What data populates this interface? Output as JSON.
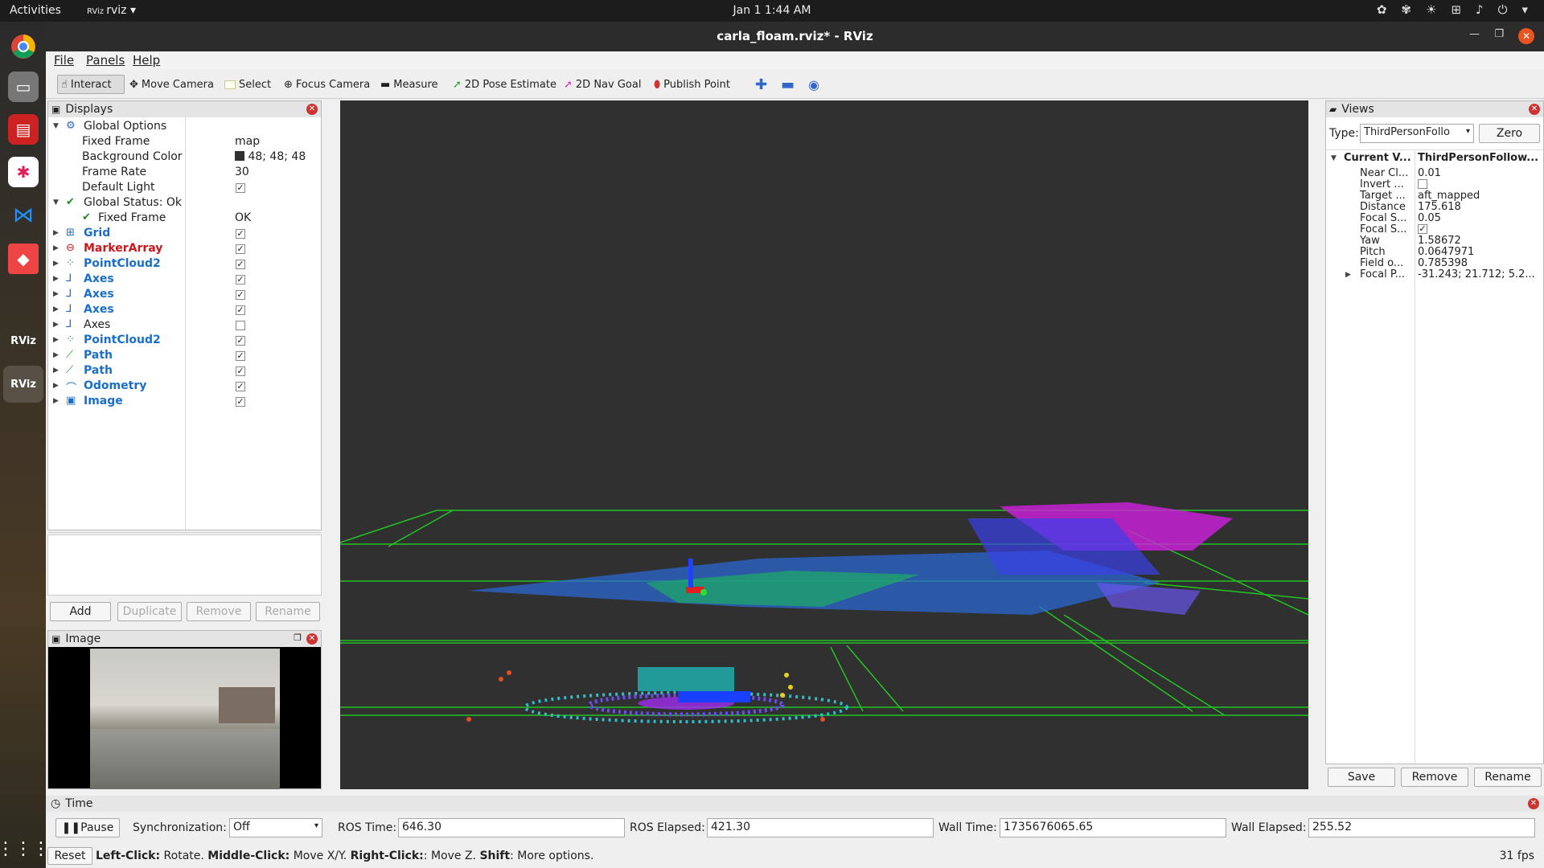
{
  "system": {
    "activities": "Activities",
    "app_menu": "rviz",
    "clock": "Jan 1  1:44 AM"
  },
  "window": {
    "title": "carla_floam.rviz* - RViz"
  },
  "menu": {
    "file": "File",
    "panels": "Panels",
    "help": "Help"
  },
  "toolbar": {
    "interact": "Interact",
    "move_camera": "Move Camera",
    "select": "Select",
    "focus_camera": "Focus Camera",
    "measure": "Measure",
    "pose_estimate": "2D Pose Estimate",
    "nav_goal": "2D Nav Goal",
    "publish_point": "Publish Point"
  },
  "displays": {
    "title": "Displays",
    "global_options": "Global Options",
    "fixed_frame_label": "Fixed Frame",
    "fixed_frame_value": "map",
    "bg_color_label": "Background Color",
    "bg_color_value": "48; 48; 48",
    "frame_rate_label": "Frame Rate",
    "frame_rate_value": "30",
    "default_light_label": "Default Light",
    "global_status": "Global Status: Ok",
    "gs_fixed_frame": "Fixed Frame",
    "gs_fixed_frame_value": "OK",
    "items": [
      {
        "label": "Grid",
        "checked": true,
        "color": "blue",
        "icon": "grid-icon",
        "glyph": "⊞"
      },
      {
        "label": "MarkerArray",
        "checked": true,
        "color": "red",
        "icon": "error-icon",
        "glyph": "⊖"
      },
      {
        "label": "PointCloud2",
        "checked": true,
        "color": "blue",
        "icon": "pointcloud-icon",
        "glyph": "⁘"
      },
      {
        "label": "Axes",
        "checked": true,
        "color": "blue",
        "icon": "axes-icon",
        "glyph": "⅃"
      },
      {
        "label": "Axes",
        "checked": true,
        "color": "blue",
        "icon": "axes-icon",
        "glyph": "⅃"
      },
      {
        "label": "Axes",
        "checked": true,
        "color": "blue",
        "icon": "axes-icon",
        "glyph": "⅃"
      },
      {
        "label": "Axes",
        "checked": false,
        "color": "plain",
        "icon": "axes-icon",
        "glyph": "⅃"
      },
      {
        "label": "PointCloud2",
        "checked": true,
        "color": "blue",
        "icon": "pointcloud-icon",
        "glyph": "⁘"
      },
      {
        "label": "Path",
        "checked": true,
        "color": "blue",
        "icon": "path-icon",
        "glyph": "⟋"
      },
      {
        "label": "Path",
        "checked": true,
        "color": "blue",
        "icon": "path-icon",
        "glyph": "⟋"
      },
      {
        "label": "Odometry",
        "checked": true,
        "color": "blue",
        "icon": "odometry-icon",
        "glyph": "⌒"
      },
      {
        "label": "Image",
        "checked": true,
        "color": "blue",
        "icon": "image-icon",
        "glyph": "▣"
      }
    ],
    "add": "Add",
    "duplicate": "Duplicate",
    "remove": "Remove",
    "rename": "Rename"
  },
  "image_panel": {
    "title": "Image"
  },
  "views": {
    "title": "Views",
    "type_label": "Type:",
    "type_value": "ThirdPersonFollo",
    "zero": "Zero",
    "current_label": "Current V...",
    "current_value": "ThirdPersonFollow...",
    "props": [
      {
        "k": "Near Cl...",
        "v": "0.01"
      },
      {
        "k": "Invert ...",
        "v": "",
        "checkbox": false
      },
      {
        "k": "Target ...",
        "v": "aft_mapped"
      },
      {
        "k": "Distance",
        "v": "175.618"
      },
      {
        "k": "Focal S...",
        "v": "0.05"
      },
      {
        "k": "Focal S...",
        "v": "",
        "checkbox": true
      },
      {
        "k": "Yaw",
        "v": "1.58672"
      },
      {
        "k": "Pitch",
        "v": "0.0647971"
      },
      {
        "k": "Field o...",
        "v": "0.785398"
      },
      {
        "k": "Focal P...",
        "v": "-31.243; 21.712; 5.2..."
      }
    ],
    "save": "Save",
    "remove": "Remove",
    "rename": "Rename"
  },
  "time": {
    "title": "Time",
    "pause": "Pause",
    "sync_label": "Synchronization:",
    "sync_value": "Off",
    "ros_time_label": "ROS Time:",
    "ros_time": "646.30",
    "ros_elapsed_label": "ROS Elapsed:",
    "ros_elapsed": "421.30",
    "wall_time_label": "Wall Time:",
    "wall_time": "1735676065.65",
    "wall_elapsed_label": "Wall Elapsed:",
    "wall_elapsed": "255.52"
  },
  "status": {
    "reset": "Reset",
    "b1": "Left-Click:",
    "t1": " Rotate. ",
    "b2": "Middle-Click:",
    "t2": " Move X/Y. ",
    "b3": "Right-Click:",
    "t3": ": Move Z. ",
    "b4": "Shift",
    "t4": ": More options.",
    "fps": "31 fps"
  }
}
